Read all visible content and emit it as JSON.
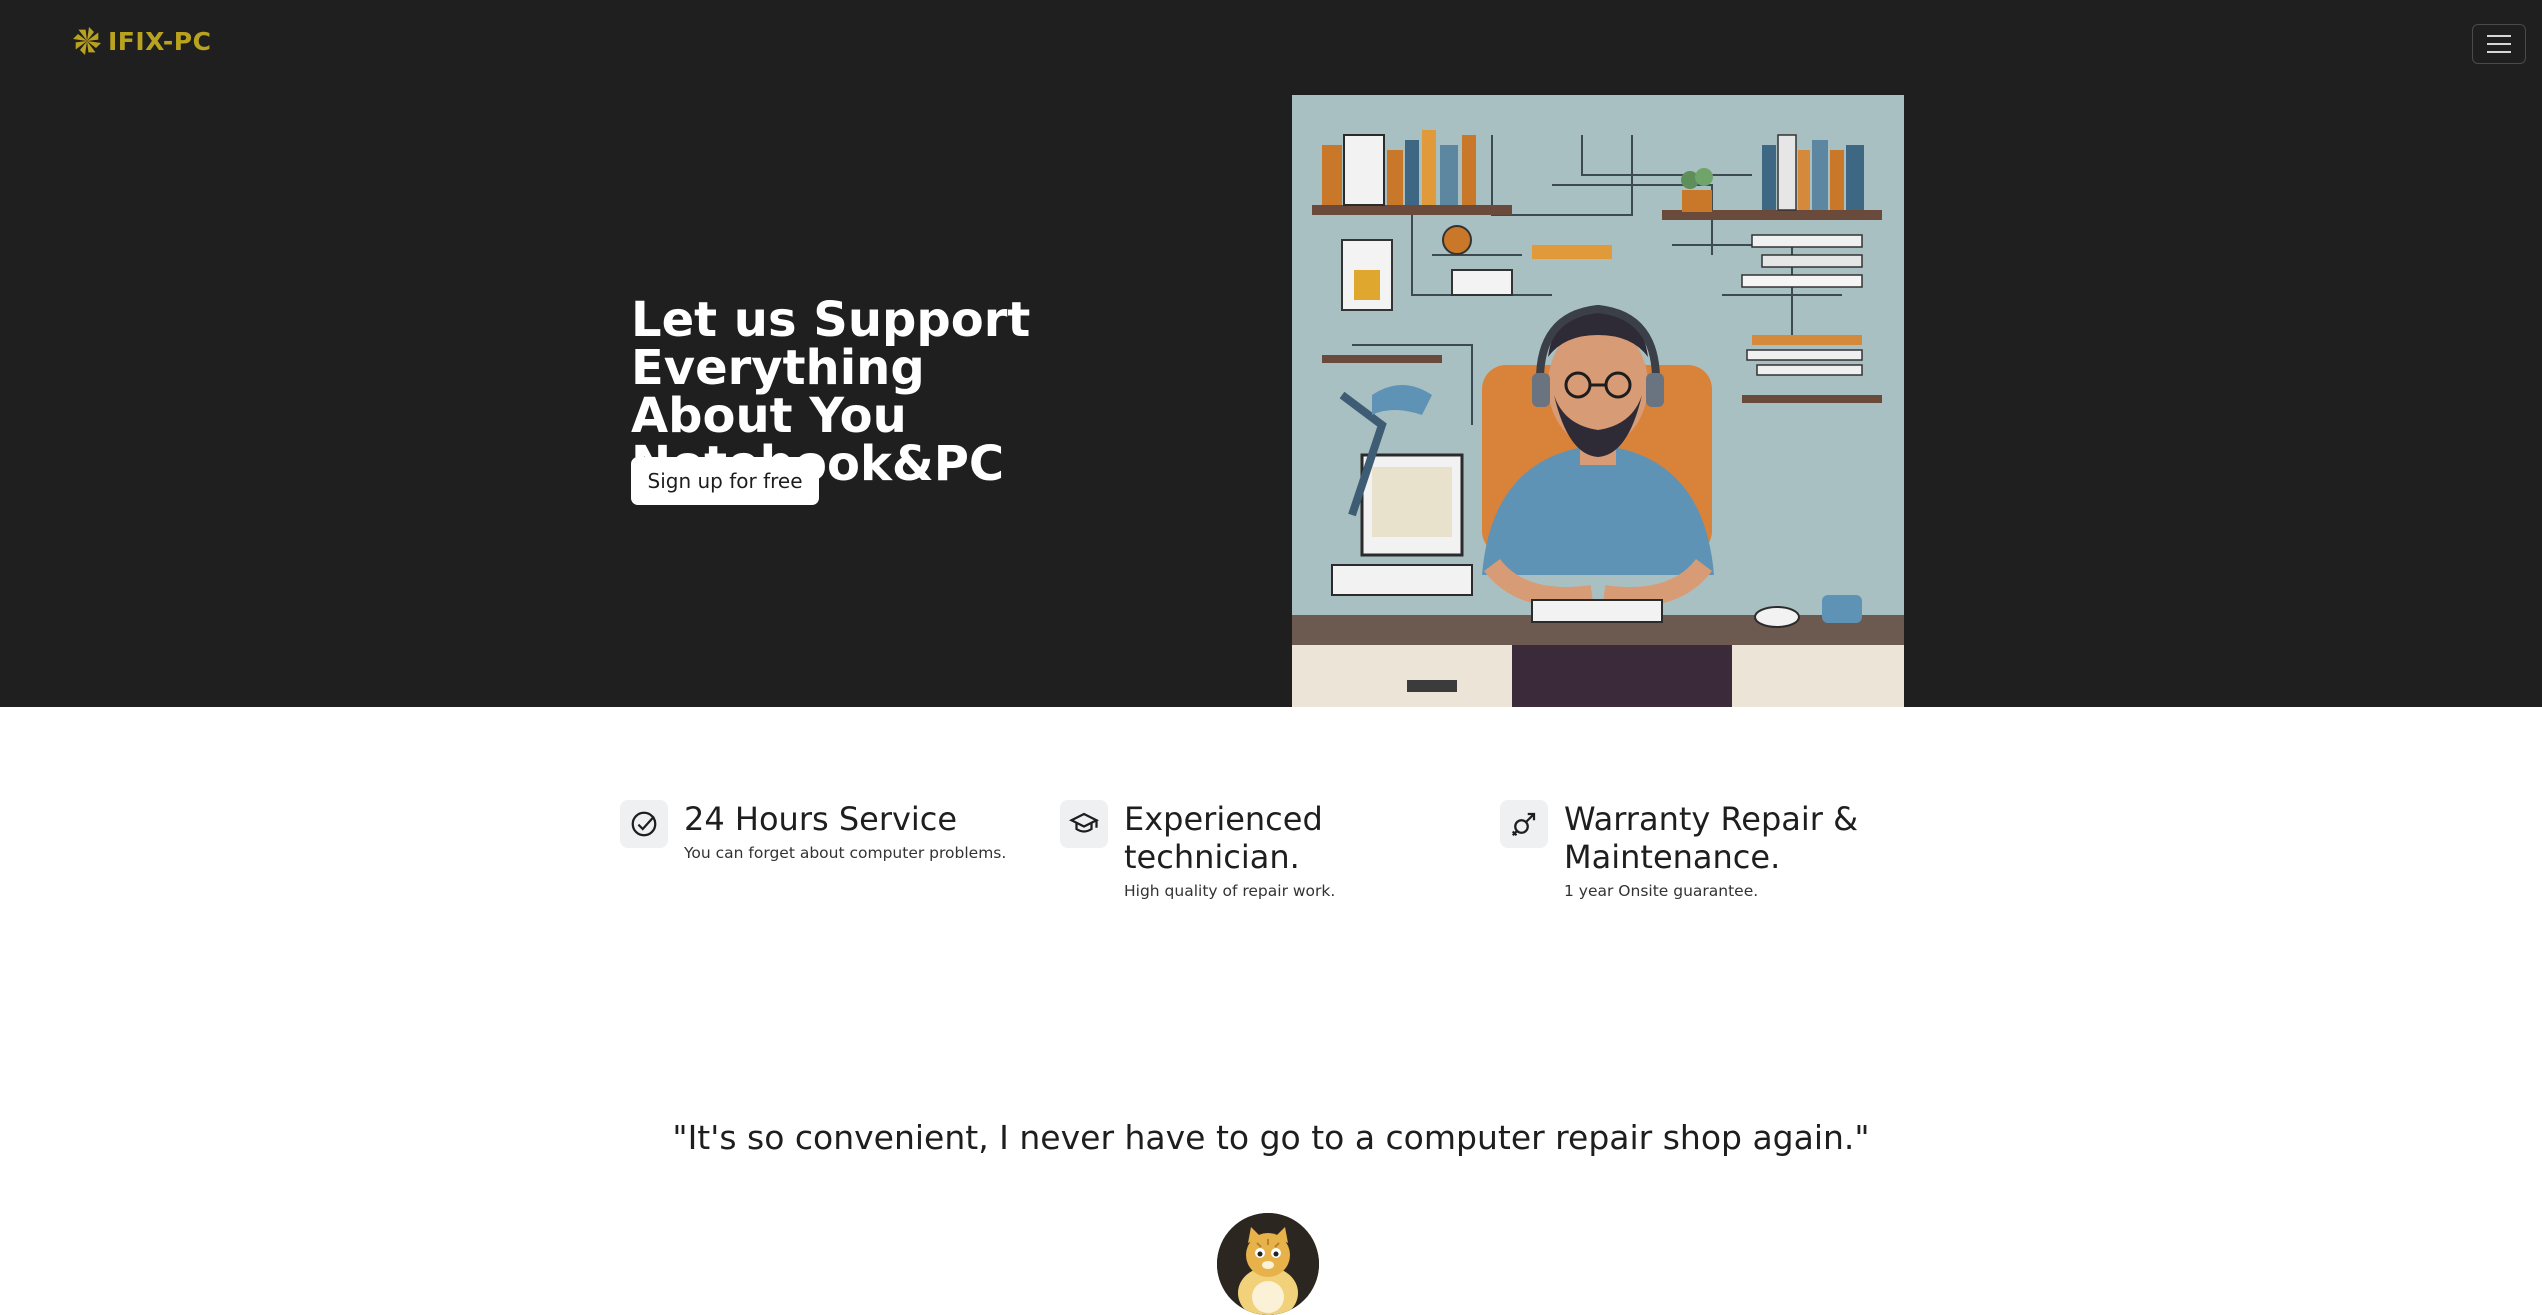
{
  "brand": {
    "name": "IFIX-PC",
    "accent_color": "#b9a21f",
    "logo_icon": "pinwheel-logo-icon"
  },
  "nav": {
    "menu_icon": "hamburger-menu-icon"
  },
  "hero": {
    "title_lines": [
      "Let us Support Everything",
      "About You",
      "Notebook&PC"
    ],
    "cta_label": "Sign up for free",
    "illustration": "technician-at-desk-illustration",
    "background_color": "#1f1f1f"
  },
  "features": [
    {
      "title": "24 Hours Service",
      "text": "You can forget about computer problems.",
      "icon": "check-circle-icon"
    },
    {
      "title": "Experienced technician.",
      "text": "High quality of repair work.",
      "icon": "graduation-cap-icon"
    },
    {
      "title": "Warranty Repair & Maintenance.",
      "text": "1 year Onsite guarantee.",
      "icon": "gender-symbol-icon"
    }
  ],
  "testimonial": {
    "quote": "\"It's so convenient, I never have to go to a computer repair shop again.\"",
    "avatar": "cat-avatar"
  }
}
